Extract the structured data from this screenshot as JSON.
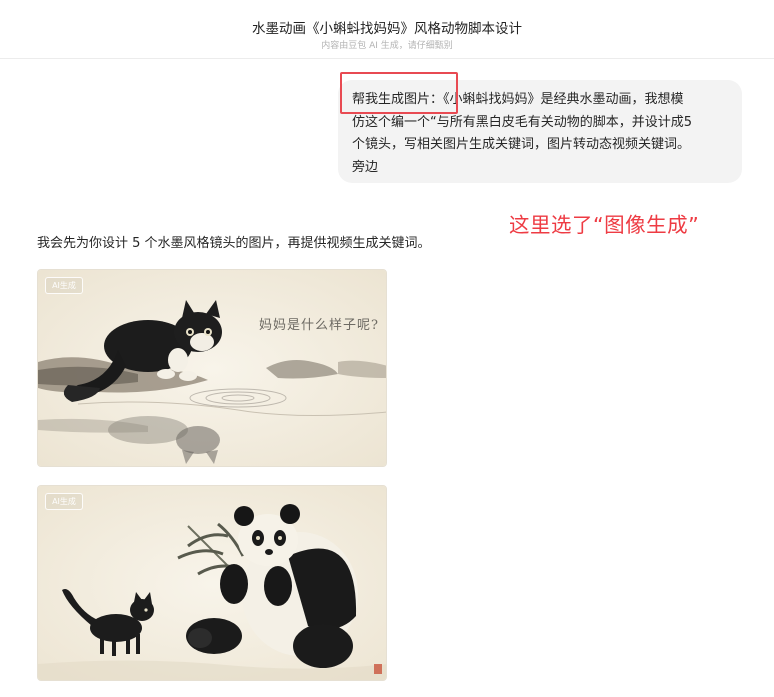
{
  "header": {
    "title": "水墨动画《小蝌蚪找妈妈》风格动物脚本设计",
    "subtitle": "内容由豆包 AI 生成，请仔细甄别"
  },
  "user_message": {
    "lines": [
      "帮我生成图片：《小蝌蚪找妈妈》是经典水墨动画，我想模",
      "仿这个编一个“与所有黑白皮毛有关动物的脚本，并设计成5",
      "个镜头，写相关图片生成关键词，图片转动态视频关键词。",
      "旁边"
    ]
  },
  "annotation": {
    "text": "这里选了“图像生成”",
    "color": "#ee3b43"
  },
  "assistant": {
    "reply": "我会先为你设计 5 个水墨风格镜头的图片，再提供视频生成关键词。",
    "images": [
      {
        "watermark": "AI生成",
        "caption": "妈妈是什么样子呢?"
      },
      {
        "watermark": "AI生成"
      }
    ]
  }
}
